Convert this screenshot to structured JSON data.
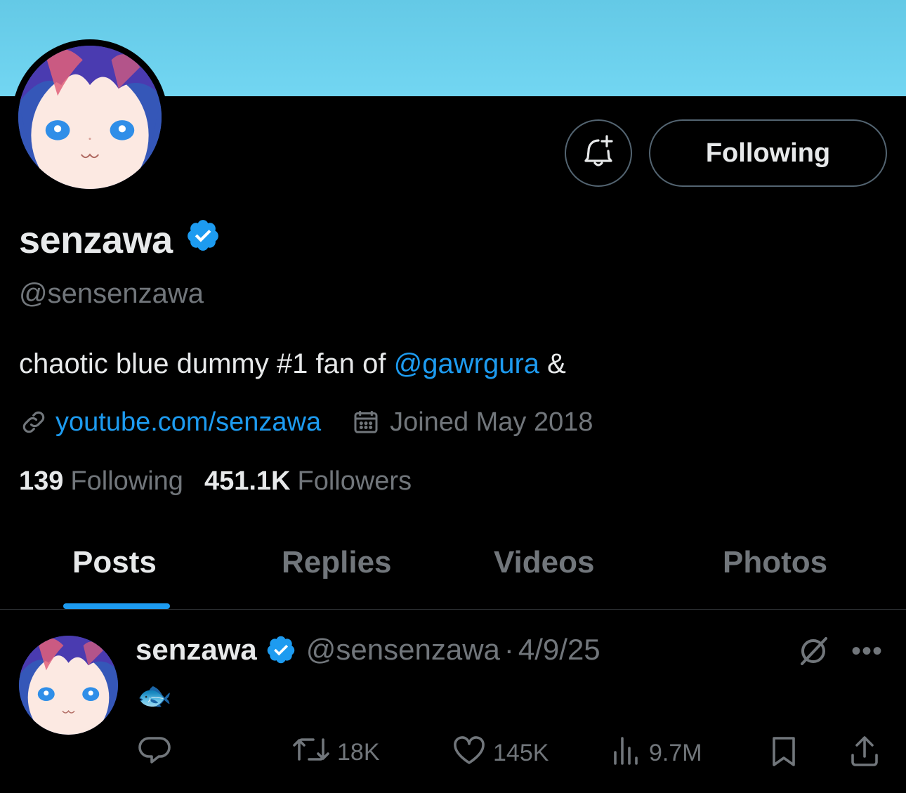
{
  "profile": {
    "display_name": "senzawa",
    "handle": "@sensenzawa",
    "bio_prefix": "chaotic blue dummy #1 fan of ",
    "bio_mention": "@gawrgura",
    "bio_suffix": " &",
    "link": "youtube.com/senzawa",
    "joined": "Joined May 2018",
    "following_count": "139",
    "following_label": "Following",
    "followers_count": "451.1K",
    "followers_label": "Followers"
  },
  "buttons": {
    "follow_state": "Following"
  },
  "tabs": [
    {
      "label": "Posts",
      "active": true
    },
    {
      "label": "Replies",
      "active": false
    },
    {
      "label": "Videos",
      "active": false
    },
    {
      "label": "Photos",
      "active": false
    }
  ],
  "post": {
    "name": "senzawa",
    "handle": "@sensenzawa",
    "separator": "·",
    "date": "4/9/25",
    "body": "🐟",
    "retweets": "18K",
    "likes": "145K",
    "views": "9.7M"
  },
  "colors": {
    "accent": "#1d9bf0",
    "banner": "#6fd3ef",
    "muted": "#71767b",
    "text": "#e7e9ea"
  },
  "icons": [
    "bell-plus-icon",
    "verified-badge-icon",
    "link-icon",
    "calendar-icon",
    "grok-icon",
    "more-icon",
    "reply-icon",
    "retweet-icon",
    "like-icon",
    "views-icon",
    "bookmark-icon",
    "share-icon"
  ]
}
